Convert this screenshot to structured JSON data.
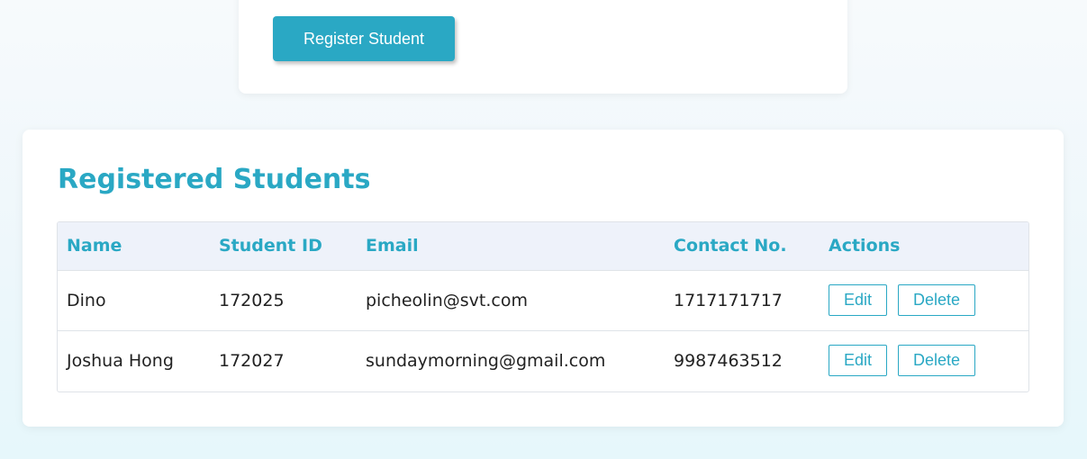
{
  "form": {
    "register_button_label": "Register Student"
  },
  "students_section": {
    "title": "Registered Students",
    "columns": [
      "Name",
      "Student ID",
      "Email",
      "Contact No.",
      "Actions"
    ],
    "rows": [
      {
        "name": "Dino",
        "student_id": "172025",
        "email": "picheolin@svt.com",
        "contact": "1717171717",
        "edit_label": "Edit",
        "delete_label": "Delete"
      },
      {
        "name": "Joshua Hong",
        "student_id": "172027",
        "email": "sundaymorning@gmail.com",
        "contact": "9987463512",
        "edit_label": "Edit",
        "delete_label": "Delete"
      }
    ]
  },
  "colors": {
    "accent": "#2aa8c4",
    "header_bg": "#eef2fa",
    "text": "#222222"
  }
}
